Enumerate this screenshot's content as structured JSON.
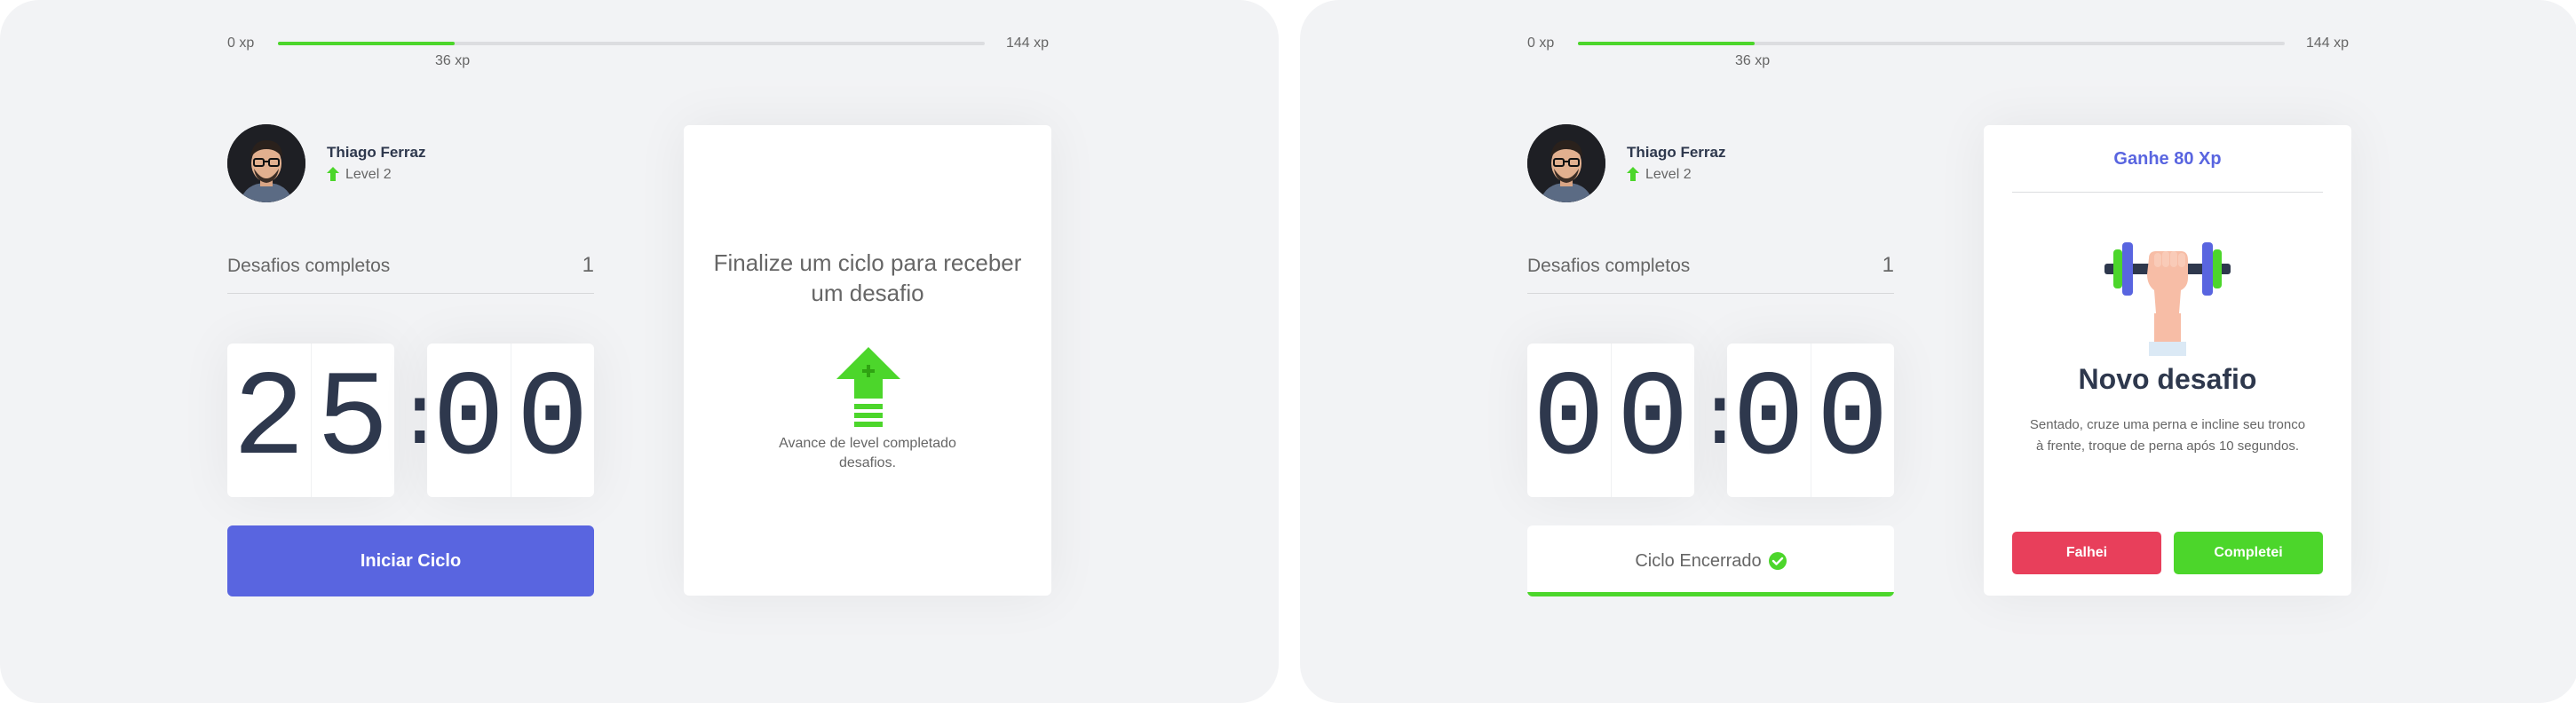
{
  "left": {
    "xp": {
      "start": "0 xp",
      "end": "144 xp",
      "current": "36 xp",
      "progress_fraction": 0.25
    },
    "profile": {
      "name": "Thiago Ferraz",
      "level": "Level 2"
    },
    "challenges": {
      "label": "Desafios completos",
      "value": "1"
    },
    "countdown": {
      "m1": "2",
      "m2": "5",
      "colon": ":",
      "s1": "0",
      "s2": "0"
    },
    "cycle_button": "Iniciar Ciclo",
    "card": {
      "title": "Finalize um ciclo para receber um desafio",
      "icon": "level-up-icon",
      "description": "Avance de level completado desafios."
    }
  },
  "right": {
    "xp": {
      "start": "0 xp",
      "end": "144 xp",
      "current": "36 xp",
      "progress_fraction": 0.25
    },
    "profile": {
      "name": "Thiago Ferraz",
      "level": "Level 2"
    },
    "challenges": {
      "label": "Desafios completos",
      "value": "1"
    },
    "countdown": {
      "m1": "0",
      "m2": "0",
      "colon": ":",
      "s1": "0",
      "s2": "0"
    },
    "cycle_button": "Ciclo Encerrado",
    "card": {
      "header": "Ganhe 80 Xp",
      "icon": "dumbbell-icon",
      "title": "Novo desafio",
      "description": "Sentado, cruze uma perna e incline seu tronco à frente, troque de perna após 10 segundos.",
      "fail_button": "Falhei",
      "success_button": "Completei"
    }
  },
  "colors": {
    "accent": "#5965e0",
    "success": "#4cd62b",
    "danger": "#e83f5b",
    "title": "#2e384d",
    "text": "#666666",
    "background": "#f2f3f5"
  }
}
